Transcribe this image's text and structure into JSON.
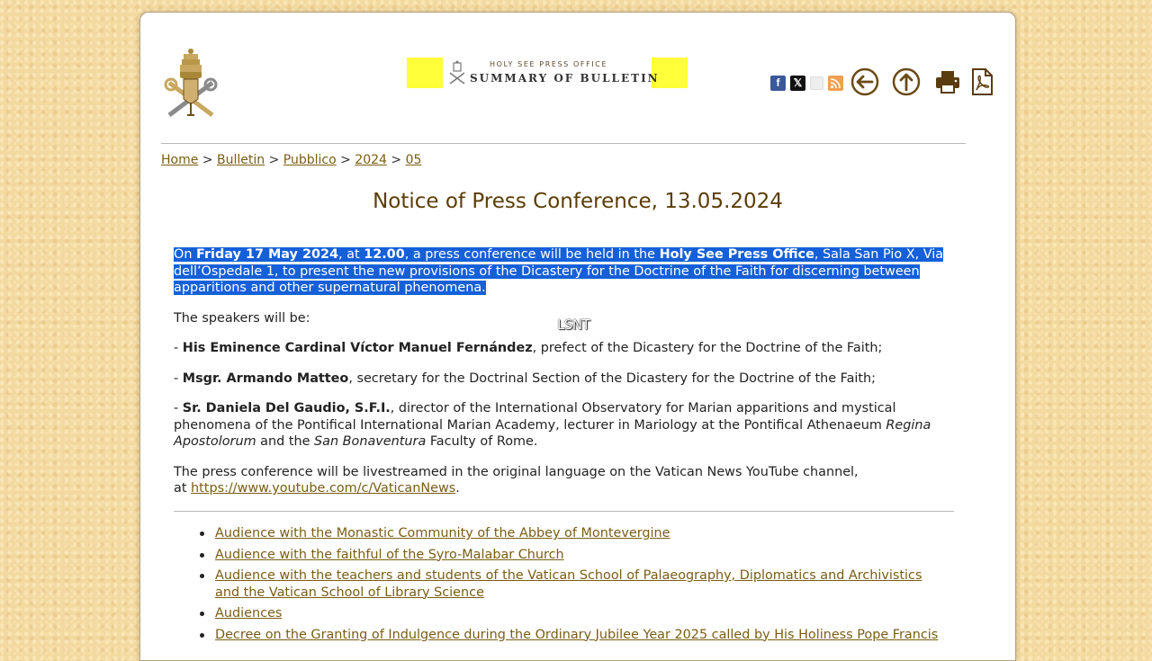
{
  "header": {
    "banner_line1": "HOLY SEE PRESS OFFICE",
    "banner_line2": "SUMMARY OF BULLETIN",
    "social": {
      "facebook": "f",
      "x": "𝕏"
    }
  },
  "breadcrumb": {
    "items": [
      "Home",
      "Bulletin",
      "Pubblico",
      "2024",
      "05"
    ],
    "separator": ">"
  },
  "page_title": "Notice of Press Conference, 13.05.2024",
  "body": {
    "intro": {
      "t1": "On ",
      "b1": "Friday 17 May 2024",
      "t2": ", at ",
      "b2": "12.00",
      "t3": ", a press conference will be held in the ",
      "b3": "Holy See Press Office",
      "t4": ", Sala San Pio X, Via dell’Ospedale 1, to present the new provisions of the Dicastery for the Doctrine of the Faith for discerning between apparitions and other supernatural phenomena."
    },
    "speakers_intro": "The speakers will be:",
    "speaker1": {
      "dash": "- ",
      "name": "His Eminence Cardinal Víctor Manuel Fernández",
      "role": ", prefect of the Dicastery for the Doctrine of the Faith;"
    },
    "speaker2": {
      "dash": "- ",
      "name": "Msgr. Armando Matteo",
      "role": ", secretary for the Doctrinal Section of the Dicastery for the Doctrine of the Faith;"
    },
    "speaker3": {
      "dash": "- ",
      "name": "Sr. Daniela Del Gaudio, S.F.I.",
      "role1": ", director of the International Observatory for Marian apparitions and mystical phenomena of the Pontifical International Marian Academy, lecturer in Mariology at the Pontifical Athenaeum ",
      "italic1": "Regina Apostolorum",
      "role2": " and the ",
      "italic2": "San Bonaventura",
      "role3": " Faculty of Rome."
    },
    "livestream": {
      "text": "The press conference will be livestreamed in the original language on the Vatican News YouTube channel,",
      "at": "at ",
      "link": "https://www.youtube.com/c/VaticanNews",
      "end": "."
    }
  },
  "watermark": "LSNT",
  "related": [
    "Audience with the Monastic Community of the Abbey of Montevergine",
    "Audience with the faithful of the Syro-Malabar Church",
    "Audience with the teachers and students of the Vatican School of Palaeography, Diplomatics and Archivistics and the Vatican School of Library Science",
    "Audiences",
    "Decree on the Granting of Indulgence during the Ordinary Jubilee Year 2025 called by His Holiness Pope Francis"
  ]
}
